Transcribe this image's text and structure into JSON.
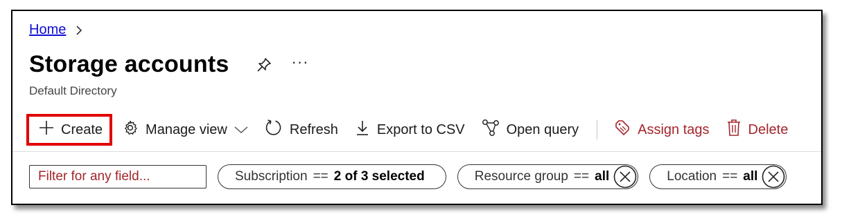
{
  "breadcrumb": {
    "home": "Home"
  },
  "page": {
    "title": "Storage accounts",
    "more": "···",
    "subtitle": "Default Directory"
  },
  "toolbar": {
    "create": "Create",
    "manage_view": "Manage view",
    "refresh": "Refresh",
    "export_csv": "Export to CSV",
    "open_query": "Open query",
    "assign_tags": "Assign tags",
    "delete": "Delete"
  },
  "filters": {
    "search_placeholder": "Filter for any field...",
    "subscription": {
      "label": "Subscription",
      "op": "==",
      "value": "2 of 3 selected"
    },
    "resource_group": {
      "label": "Resource group",
      "op": "==",
      "value": "all"
    },
    "location": {
      "label": "Location",
      "op": "==",
      "value": "all"
    }
  },
  "colors": {
    "link": "#0d0dd6",
    "danger": "#a4262c",
    "highlight": "#e00000"
  },
  "icons": [
    "chevron-right-icon",
    "pin-icon",
    "plus-icon",
    "gear-icon",
    "chevron-down-icon",
    "refresh-icon",
    "download-icon",
    "query-icon",
    "tag-icon",
    "trash-icon",
    "close-icon"
  ]
}
